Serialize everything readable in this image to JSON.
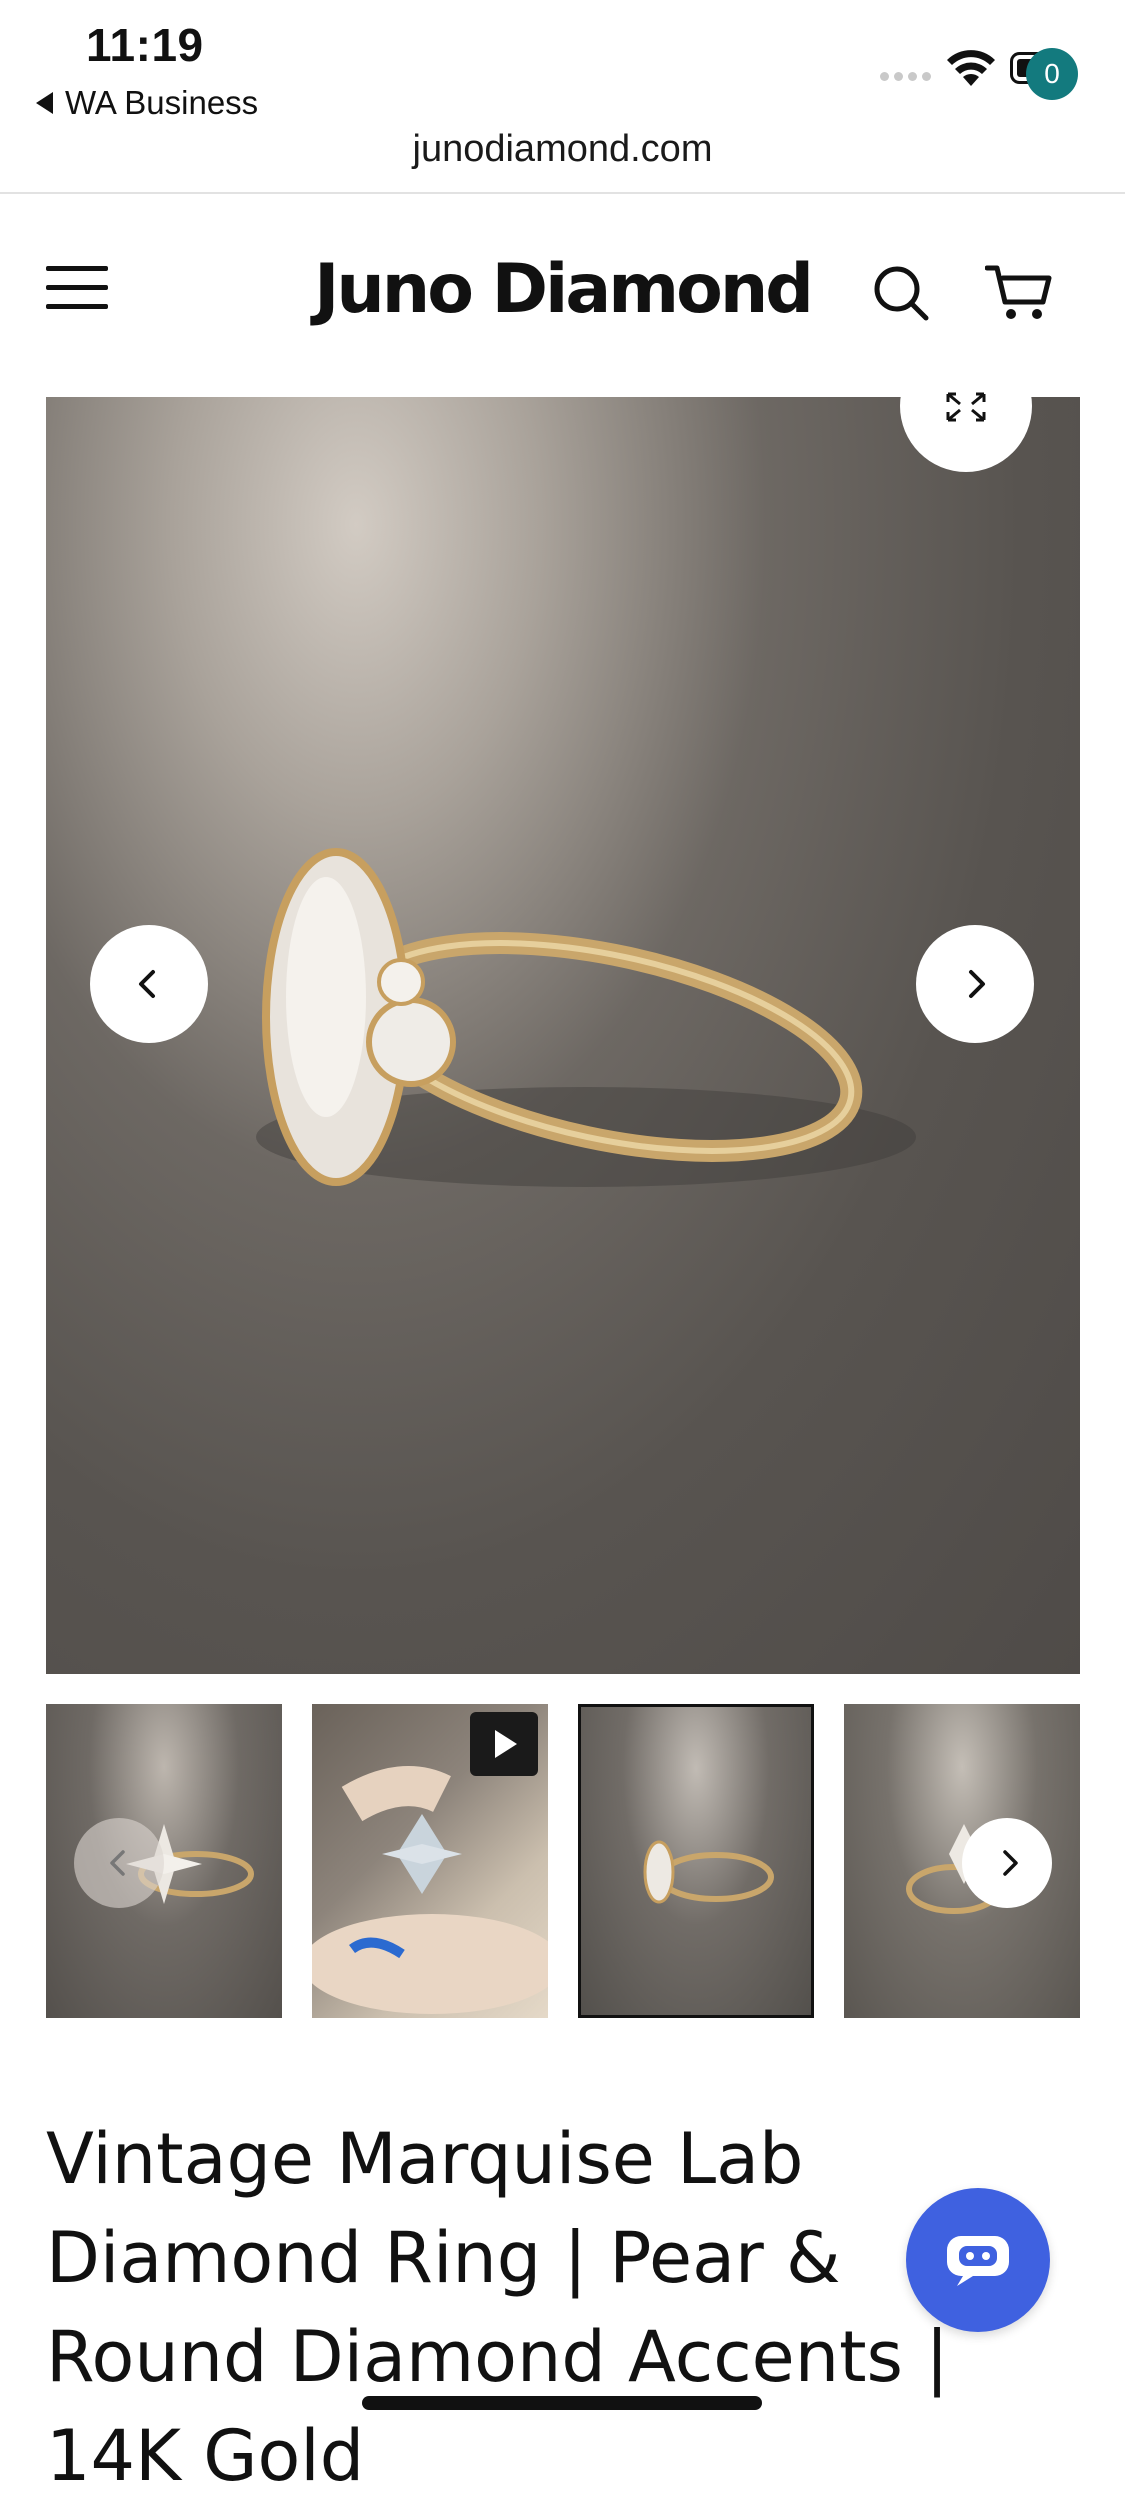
{
  "status_bar": {
    "time": "11:19",
    "back_app_label": "WA Business"
  },
  "browser": {
    "url": "junodiamond.com"
  },
  "header": {
    "logo_text": "Juno Diamond",
    "cart_count": "0",
    "badge_color": "#137a7e"
  },
  "gallery": {
    "thumbnail_count": 4,
    "selected_thumbnail": 3,
    "video_thumbnail": 2
  },
  "product": {
    "title": "Vintage Marquise Lab Diamond Ring | Pear & Round Diamond Accents | 14K Gold"
  },
  "colors": {
    "chat_button": "#3f61e0",
    "accent": "#137a7e"
  }
}
